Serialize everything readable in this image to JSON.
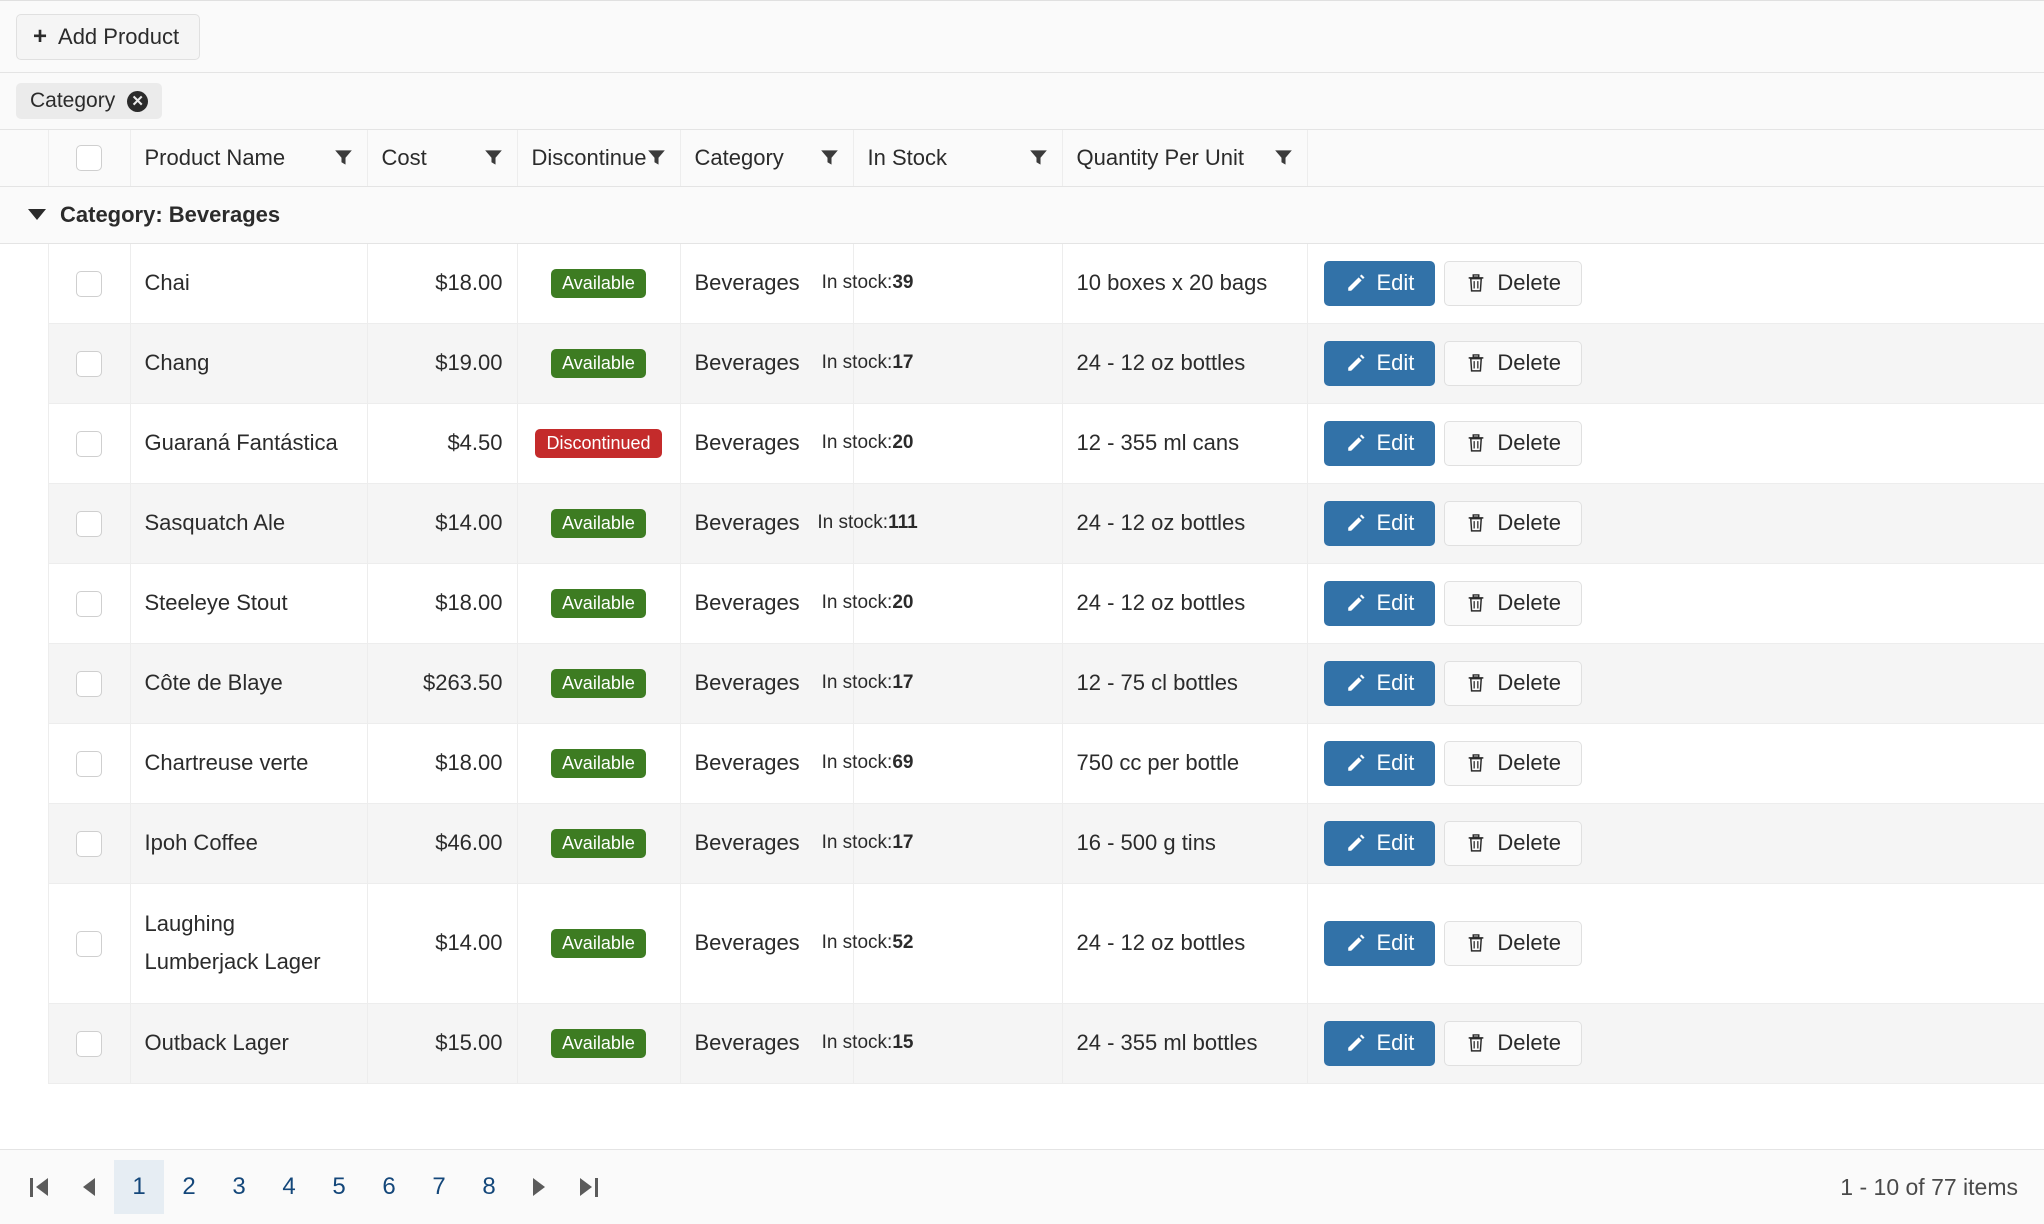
{
  "toolbar": {
    "add_label": "Add Product",
    "add_icon": "plus-icon"
  },
  "groupbar": {
    "chips": [
      {
        "label": "Category",
        "remove_icon": "remove-circle-icon"
      }
    ]
  },
  "columns": [
    {
      "key": "name",
      "label": "Product Name",
      "filter_icon": "funnel-icon"
    },
    {
      "key": "cost",
      "label": "Cost",
      "filter_icon": "funnel-icon"
    },
    {
      "key": "disc",
      "label": "Discontinued",
      "filter_icon": "funnel-icon"
    },
    {
      "key": "cat",
      "label": "Category",
      "filter_icon": "funnel-icon"
    },
    {
      "key": "stock",
      "label": "In Stock",
      "filter_icon": "funnel-icon"
    },
    {
      "key": "qty",
      "label": "Quantity Per Unit",
      "filter_icon": "funnel-icon"
    }
  ],
  "group": {
    "label": "Category: Beverages",
    "expanded": true,
    "caret_icon": "caret-down-icon"
  },
  "stock": {
    "prefix": "In stock:",
    "max": 125
  },
  "status_labels": {
    "available": "Available",
    "discontinued": "Discontinued"
  },
  "row_actions": {
    "edit_label": "Edit",
    "edit_icon": "pencil-icon",
    "delete_label": "Delete",
    "delete_icon": "trash-icon"
  },
  "colors": {
    "available": "#3d7c22",
    "discontinued": "#c42b2b",
    "progress_fill": "#3272a8",
    "progress_track": "#e9e9e9",
    "primary_button": "#3272a8",
    "pager_link": "#14477a"
  },
  "rows": [
    {
      "name": "Chai",
      "cost": "$18.00",
      "status": "Available",
      "category": "Beverages",
      "stock": 39,
      "stock_label": "In stock:",
      "qty": "10 boxes x 20 bags"
    },
    {
      "name": "Chang",
      "cost": "$19.00",
      "status": "Available",
      "category": "Beverages",
      "stock": 17,
      "stock_label": "In stock:",
      "qty": "24 - 12 oz bottles"
    },
    {
      "name": "Guaraná Fantástica",
      "cost": "$4.50",
      "status": "Discontinued",
      "category": "Beverages",
      "stock": 20,
      "stock_label": "In stock:",
      "qty": "12 - 355 ml cans"
    },
    {
      "name": "Sasquatch Ale",
      "cost": "$14.00",
      "status": "Available",
      "category": "Beverages",
      "stock": 111,
      "stock_label": "In stock:",
      "qty": "24 - 12 oz bottles"
    },
    {
      "name": "Steeleye Stout",
      "cost": "$18.00",
      "status": "Available",
      "category": "Beverages",
      "stock": 20,
      "stock_label": "In stock:",
      "qty": "24 - 12 oz bottles"
    },
    {
      "name": "Côte de Blaye",
      "cost": "$263.50",
      "status": "Available",
      "category": "Beverages",
      "stock": 17,
      "stock_label": "In stock:",
      "qty": "12 - 75 cl bottles"
    },
    {
      "name": "Chartreuse verte",
      "cost": "$18.00",
      "status": "Available",
      "category": "Beverages",
      "stock": 69,
      "stock_label": "In stock:",
      "qty": "750 cc per bottle"
    },
    {
      "name": "Ipoh Coffee",
      "cost": "$46.00",
      "status": "Available",
      "category": "Beverages",
      "stock": 17,
      "stock_label": "In stock:",
      "qty": "16 - 500 g tins"
    },
    {
      "name": "Laughing Lumberjack Lager",
      "cost": "$14.00",
      "status": "Available",
      "category": "Beverages",
      "stock": 52,
      "stock_label": "In stock:",
      "qty": "24 - 12 oz bottles"
    },
    {
      "name": "Outback Lager",
      "cost": "$15.00",
      "status": "Available",
      "category": "Beverages",
      "stock": 15,
      "stock_label": "In stock:",
      "qty": "24 - 355 ml bottles"
    }
  ],
  "pager": {
    "first_icon": "go-to-first-page-icon",
    "prev_icon": "previous-page-icon",
    "next_icon": "next-page-icon",
    "last_icon": "go-to-last-page-icon",
    "pages": [
      "1",
      "2",
      "3",
      "4",
      "5",
      "6",
      "7",
      "8"
    ],
    "selected": "1",
    "info": "1 - 10 of 77 items"
  }
}
